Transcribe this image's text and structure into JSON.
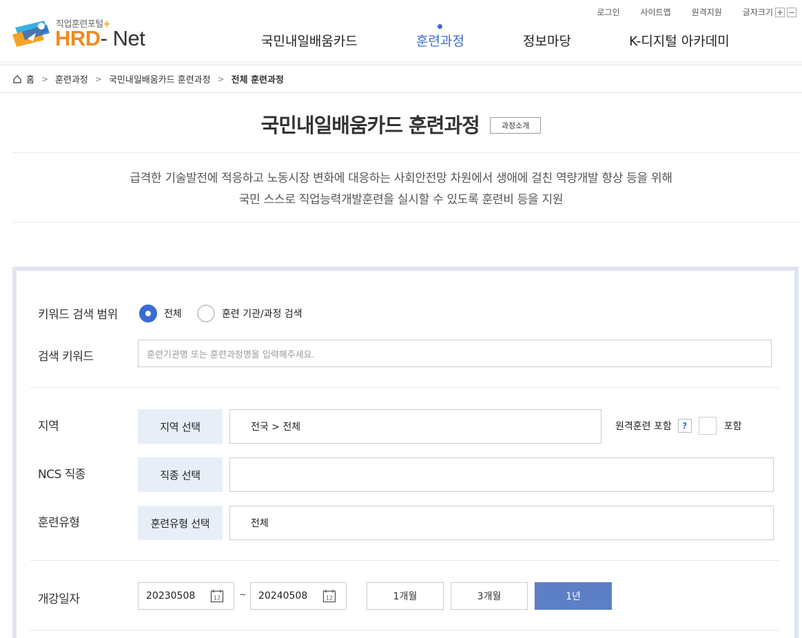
{
  "header": {
    "logo_sub": "직업훈련포털",
    "logo_plus": "+",
    "logo_hrd": "HRD",
    "logo_net": "- Net",
    "util": {
      "login": "로그인",
      "sitemap": "사이트맵",
      "remote": "원격지원",
      "fontsize": "글자크기",
      "plus": "+",
      "minus": "−"
    },
    "gnb": [
      {
        "label": "국민내일배움카드",
        "active": false
      },
      {
        "label": "훈련과정",
        "active": true
      },
      {
        "label": "정보마당",
        "active": false
      },
      {
        "label": "K-디지털 아카데미",
        "active": false
      }
    ]
  },
  "breadcrumb": [
    "홈",
    "훈련과정",
    "국민내일배움카드 훈련과정",
    "전체 훈련과정"
  ],
  "title": {
    "text": "국민내일배움카드 훈련과정",
    "intro_button": "과정소개"
  },
  "description": {
    "line1": "급격한 기술발전에 적응하고 노동시장 변화에 대응하는 사회안전망 차원에서 생애에 걸친 역량개발 향상 등을 위해",
    "line2": "국민 스스로 직업능력개발훈련을 실시할 수 있도록 훈련비 등을 지원"
  },
  "search": {
    "scope_label": "키워드 검색 범위",
    "scope_options": [
      {
        "label": "전체",
        "checked": true
      },
      {
        "label": "훈련 기관/과정 검색",
        "checked": false
      }
    ],
    "keyword_label": "검색 키워드",
    "keyword_placeholder": "훈련기관명 또는 훈련과정명을 입력해주세요.",
    "region_label": "지역",
    "region_button": "지역 선택",
    "region_value": "전국 > 전체",
    "remote_label": "원격훈련 포함",
    "remote_help": "?",
    "remote_include": "포함",
    "ncs_label": "NCS 직종",
    "ncs_button": "직종 선택",
    "ncs_value": "",
    "type_label": "훈련유형",
    "type_button": "훈련유형 선택",
    "type_value": "전체",
    "date_label": "개강일자",
    "date_from": "20230508",
    "date_to": "20240508",
    "date_tilde": "~",
    "calendar_day": "12",
    "periods": [
      {
        "label": "1개월",
        "active": false
      },
      {
        "label": "3개월",
        "active": false
      },
      {
        "label": "1년",
        "active": true
      }
    ]
  }
}
